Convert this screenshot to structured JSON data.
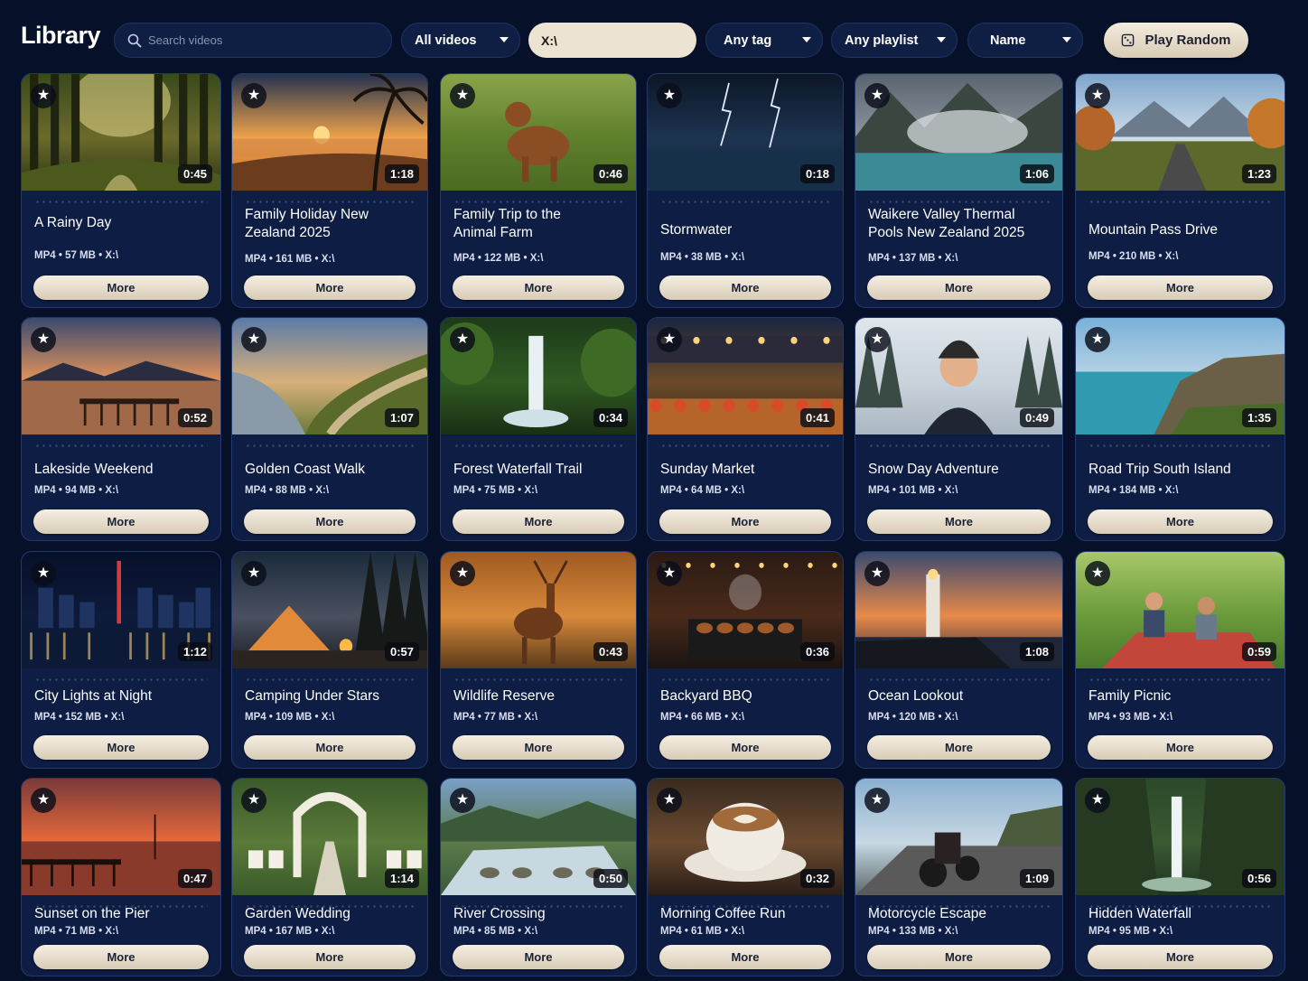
{
  "app": {
    "title": "Library"
  },
  "search": {
    "placeholder": "Search videos",
    "value": ""
  },
  "filters": {
    "type": "All videos",
    "path": "X:\\",
    "tag": "Any tag",
    "playlist": "Any playlist",
    "sort": "Name"
  },
  "actions": {
    "play_random": "Play Random",
    "more_label": "More",
    "star_glyph": "★"
  },
  "videos": [
    {
      "title": "A Rainy Day",
      "meta": "MP4 • 57 MB • X:\\",
      "duration": "0:45",
      "scene": "forest"
    },
    {
      "title": "Family Holiday New Zealand 2025",
      "meta": "MP4 • 161 MB • X:\\",
      "duration": "1:18",
      "scene": "beach-sunset"
    },
    {
      "title": "Family Trip to the Animal Farm",
      "meta": "MP4 • 122 MB • X:\\",
      "duration": "0:46",
      "scene": "dog"
    },
    {
      "title": "Stormwater",
      "meta": "MP4 • 38 MB • X:\\",
      "duration": "0:18",
      "scene": "storm"
    },
    {
      "title": "Waikere Valley Thermal Pools New Zealand 2025",
      "meta": "MP4 • 137 MB • X:\\",
      "duration": "1:06",
      "scene": "thermal"
    },
    {
      "title": "Mountain Pass Drive",
      "meta": "MP4 • 210 MB • X:\\",
      "duration": "1:23",
      "scene": "mountain-road"
    },
    {
      "title": "Lakeside Weekend",
      "meta": "MP4 • 94 MB • X:\\",
      "duration": "0:52",
      "scene": "lake-pier"
    },
    {
      "title": "Golden Coast Walk",
      "meta": "MP4 • 88 MB • X:\\",
      "duration": "1:07",
      "scene": "coast-path"
    },
    {
      "title": "Forest Waterfall Trail",
      "meta": "MP4 • 75 MB • X:\\",
      "duration": "0:34",
      "scene": "waterfall"
    },
    {
      "title": "Sunday Market",
      "meta": "MP4 • 64 MB • X:\\",
      "duration": "0:41",
      "scene": "market"
    },
    {
      "title": "Snow Day Adventure",
      "meta": "MP4 • 101 MB • X:\\",
      "duration": "0:49",
      "scene": "snow"
    },
    {
      "title": "Road Trip South Island",
      "meta": "MP4 • 184 MB • X:\\",
      "duration": "1:35",
      "scene": "cliffs"
    },
    {
      "title": "City Lights at Night",
      "meta": "MP4 • 152 MB • X:\\",
      "duration": "1:12",
      "scene": "city"
    },
    {
      "title": "Camping Under Stars",
      "meta": "MP4 • 109 MB • X:\\",
      "duration": "0:57",
      "scene": "camping"
    },
    {
      "title": "Wildlife Reserve",
      "meta": "MP4 • 77 MB • X:\\",
      "duration": "0:43",
      "scene": "deer"
    },
    {
      "title": "Backyard BBQ",
      "meta": "MP4 • 66 MB • X:\\",
      "duration": "0:36",
      "scene": "bbq"
    },
    {
      "title": "Ocean Lookout",
      "meta": "MP4 • 120 MB • X:\\",
      "duration": "1:08",
      "scene": "lighthouse"
    },
    {
      "title": "Family Picnic",
      "meta": "MP4 • 93 MB • X:\\",
      "duration": "0:59",
      "scene": "picnic"
    },
    {
      "title": "Sunset on the Pier",
      "meta": "MP4 • 71 MB • X:\\",
      "duration": "0:47",
      "scene": "pier-sunset"
    },
    {
      "title": "Garden Wedding",
      "meta": "MP4 • 167 MB • X:\\",
      "duration": "1:14",
      "scene": "wedding"
    },
    {
      "title": "River Crossing",
      "meta": "MP4 • 85 MB • X:\\",
      "duration": "0:50",
      "scene": "river"
    },
    {
      "title": "Morning Coffee Run",
      "meta": "MP4 • 61 MB • X:\\",
      "duration": "0:32",
      "scene": "coffee"
    },
    {
      "title": "Motorcycle Escape",
      "meta": "MP4 • 133 MB • X:\\",
      "duration": "1:09",
      "scene": "motorcycle"
    },
    {
      "title": "Hidden Waterfall",
      "meta": "MP4 • 95 MB • X:\\",
      "duration": "0:56",
      "scene": "hidden-waterfall"
    }
  ]
}
